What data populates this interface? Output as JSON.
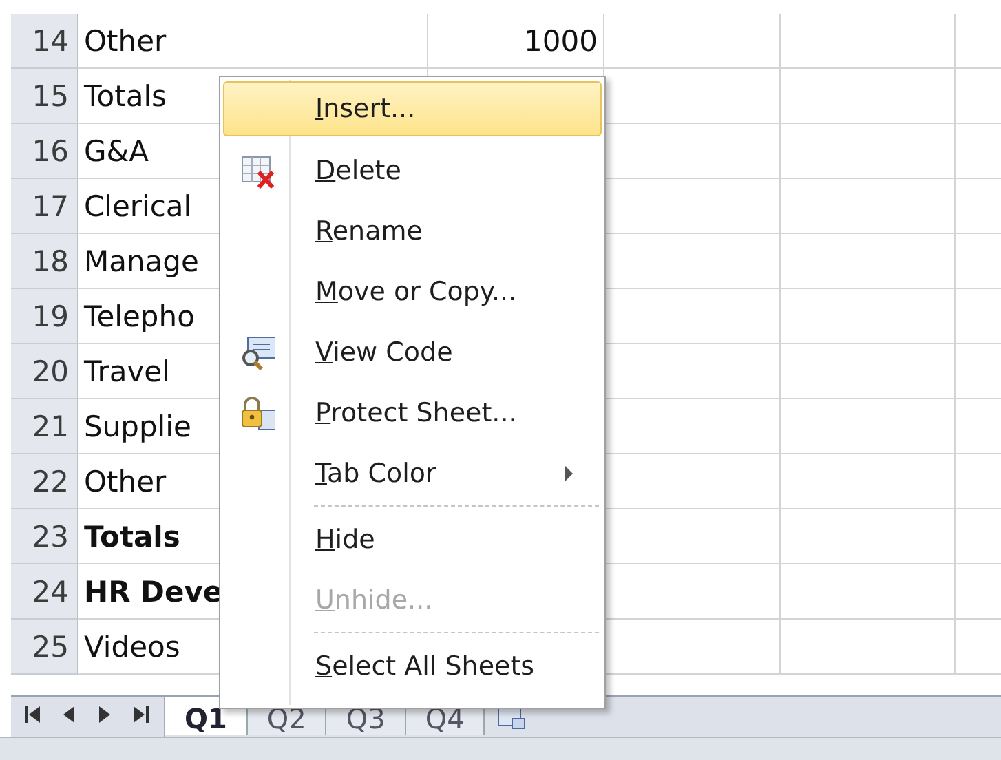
{
  "sheet": {
    "rows": [
      {
        "number": "14",
        "cells": [
          {
            "text": "Other",
            "bold": false
          },
          {
            "text": "1000",
            "bold": false
          }
        ]
      },
      {
        "number": "15",
        "cells": [
          {
            "text": "Totals",
            "bold": false
          }
        ]
      },
      {
        "number": "16",
        "cells": [
          {
            "text": "G&A",
            "bold": false
          }
        ]
      },
      {
        "number": "17",
        "cells": [
          {
            "text": "Clerical",
            "bold": false
          }
        ]
      },
      {
        "number": "18",
        "cells": [
          {
            "text": "Manage",
            "bold": false
          }
        ]
      },
      {
        "number": "19",
        "cells": [
          {
            "text": "Telepho",
            "bold": false
          }
        ]
      },
      {
        "number": "20",
        "cells": [
          {
            "text": "Travel",
            "bold": false
          }
        ]
      },
      {
        "number": "21",
        "cells": [
          {
            "text": "Supplie",
            "bold": false
          }
        ]
      },
      {
        "number": "22",
        "cells": [
          {
            "text": "Other",
            "bold": false
          }
        ]
      },
      {
        "number": "23",
        "cells": [
          {
            "text": "Totals",
            "bold": true
          }
        ]
      },
      {
        "number": "24",
        "cells": [
          {
            "text": "HR Deve",
            "bold": true
          }
        ]
      },
      {
        "number": "25",
        "cells": [
          {
            "text": "Videos",
            "bold": false
          }
        ]
      }
    ]
  },
  "sheet_tabs": [
    {
      "label": "Q1",
      "selected": true
    },
    {
      "label": "Q2",
      "selected": false
    },
    {
      "label": "Q3",
      "selected": false
    },
    {
      "label": "Q4",
      "selected": false
    }
  ],
  "context_menu": {
    "items": [
      {
        "kind": "item",
        "label": "Insert...",
        "selected": true,
        "disabled": false
      },
      {
        "kind": "item",
        "label": "Delete",
        "selected": false,
        "disabled": false
      },
      {
        "kind": "item",
        "label": "Rename",
        "selected": false,
        "disabled": false
      },
      {
        "kind": "item",
        "label": "Move or Copy...",
        "selected": false,
        "disabled": false
      },
      {
        "kind": "item",
        "label": "View Code",
        "selected": false,
        "disabled": false
      },
      {
        "kind": "item",
        "label": "Protect Sheet...",
        "selected": false,
        "disabled": false
      },
      {
        "kind": "item",
        "label": "Tab Color",
        "submenu": true,
        "selected": false,
        "disabled": false
      },
      {
        "kind": "separator"
      },
      {
        "kind": "item",
        "label": "Hide",
        "selected": false,
        "disabled": false
      },
      {
        "kind": "item",
        "label": "Unhide...",
        "selected": false,
        "disabled": true
      },
      {
        "kind": "separator"
      },
      {
        "kind": "item",
        "label": "Select All Sheets",
        "selected": false,
        "disabled": false
      }
    ]
  }
}
